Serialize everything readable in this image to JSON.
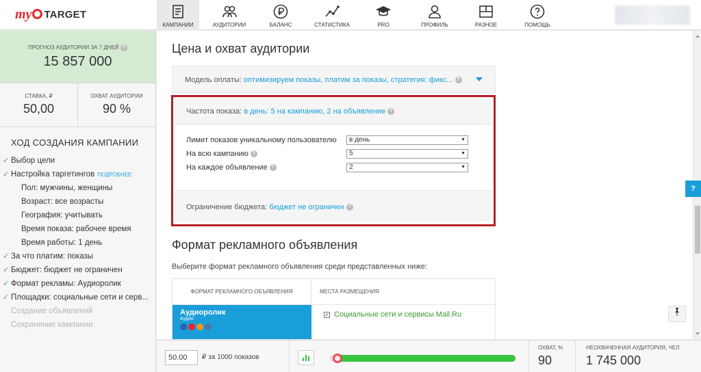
{
  "header": {
    "logo_my": "my",
    "logo_target": "TARGET",
    "nav": [
      {
        "label": "КАМПАНИИ",
        "icon": "campaigns-icon"
      },
      {
        "label": "АУДИТОРИИ",
        "icon": "audiences-icon"
      },
      {
        "label": "БАЛАНС",
        "icon": "ruble-icon"
      },
      {
        "label": "СТАТИСТИКА",
        "icon": "statistics-icon"
      },
      {
        "label": "PRO",
        "icon": "graduation-cap-icon"
      },
      {
        "label": "ПРОФИЛЬ",
        "icon": "profile-icon"
      },
      {
        "label": "РАЗНОЕ",
        "icon": "misc-icon"
      },
      {
        "label": "ПОМОЩЬ",
        "icon": "help-icon"
      }
    ],
    "active_nav": "КАМПАНИИ"
  },
  "sidebar": {
    "forecast_label": "ПРОГНОЗ АУДИТОРИИ ЗА 7 ДНЕЙ",
    "forecast_value": "15 857 000",
    "rate_label": "СТАВКА, ₽",
    "rate_value": "50,00",
    "coverage_label": "ОХВАТ АУДИТОРИИ",
    "coverage_value": "90 %",
    "steps_title": "ХОД СОЗДАНИЯ КАМПАНИИ",
    "more_label": "ПОДРОБНЕЕ",
    "steps": [
      {
        "text": "Выбор цели",
        "state": "done"
      },
      {
        "text": "Настройка таргетингов",
        "state": "done"
      },
      {
        "text": "Пол: мужчины, женщины",
        "state": "sub"
      },
      {
        "text": "Возраст: все возрасты",
        "state": "sub"
      },
      {
        "text": "География: учитывать",
        "state": "sub"
      },
      {
        "text": "Время показа: рабочее время",
        "state": "sub"
      },
      {
        "text": "Время работы: 1 день",
        "state": "sub"
      },
      {
        "text": "За что платим: показы",
        "state": "done"
      },
      {
        "text": "Бюджет: бюджет не ограничен",
        "state": "done"
      },
      {
        "text": "Формат рекламы: Аудиоролик",
        "state": "done"
      },
      {
        "text": "Площадки: социальные сети и серв...",
        "state": "done"
      },
      {
        "text": "Создание объявлений",
        "state": "pending"
      },
      {
        "text": "Сохранение кампании",
        "state": "pending"
      }
    ]
  },
  "main": {
    "price_title": "Цена и охват аудитории",
    "payment_model_label": "Модель оплаты:",
    "payment_model_value": "оптимизируем показы, платим за показы, стратегия: фикс...",
    "frequency_label": "Частота показа:",
    "frequency_value": "в день: 5 на кампанию, 2 на объявление",
    "frequency_rows": [
      {
        "label": "Лимит показов уникальному пользователю",
        "value": "в день",
        "help": false
      },
      {
        "label": "На всю кампанию",
        "value": "5",
        "help": true
      },
      {
        "label": "На каждое объявление",
        "value": "2",
        "help": true
      }
    ],
    "budget_label": "Ограничение бюджета:",
    "budget_value": "бюджет не ограничен",
    "format_title": "Формат рекламного объявления",
    "format_hint": "Выберите формат рекламного объявления среди представленных ниже:",
    "format_col1": "ФОРМАТ РЕКЛАМНОГО ОБЪЯВЛЕНИЯ",
    "format_col2": "МЕСТА РАЗМЕЩЕНИЯ",
    "format_name": "Аудиоролик",
    "format_sub": "Аудио",
    "placement": "Социальные сети и сервисы Mail.Ru",
    "placement_checked": true
  },
  "bottombar": {
    "bid_value": "50.00",
    "bid_label": "₽ за 1000 показов",
    "slider_fill_fraction": 0.9,
    "coverage_label": "ОХВАТ, %",
    "coverage_value": "90",
    "unreached_label": "НЕОХВАЧЕННАЯ АУДИТОРИЯ, ЧЕЛ",
    "unreached_value": "1 745 000"
  },
  "widgets": {
    "help_label": "?",
    "pin_icon": "pin-icon"
  },
  "colors": {
    "accent": "#1a9ed9",
    "highlight_border": "#b71d24",
    "forecast_bg": "#d5ead2",
    "slider_green": "#35c43d",
    "brand_red": "#e8262d"
  }
}
